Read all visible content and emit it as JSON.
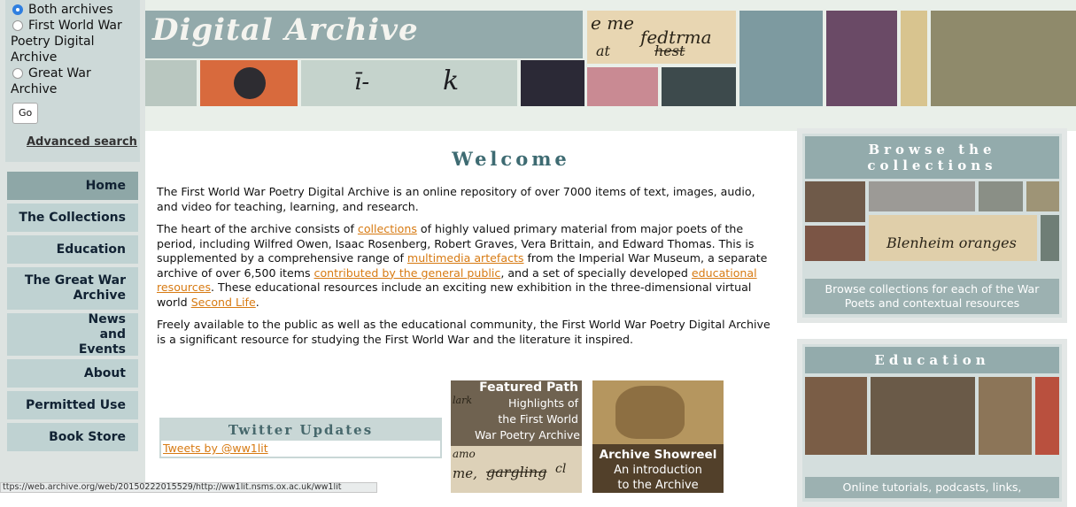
{
  "search": {
    "options": [
      "Both archives",
      "First World War Poetry Digital Archive",
      "Great War Archive"
    ],
    "go_label": "Go",
    "advanced_label": "Advanced search"
  },
  "nav": {
    "items": [
      "Home",
      "The Collections",
      "Education",
      "The Great War Archive",
      "News and Events",
      "About",
      "Permitted Use",
      "Book Store"
    ]
  },
  "header": {
    "title": "Digital Archive",
    "handwriting": [
      "e me",
      "fedtrma",
      "at",
      "hest"
    ]
  },
  "main": {
    "welcome": "Welcome",
    "p1": "The First World War Poetry Digital Archive is an online repository of over 7000 items of text, images, audio, and video for teaching, learning, and research.",
    "p2": {
      "t1": "The heart of the archive consists of ",
      "l1": "collections",
      "t2": " of highly valued primary material from major poets of the period, including Wilfred Owen, Isaac Rosenberg, Robert Graves, Vera Brittain, and Edward Thomas. This is supplemented by a comprehensive range of ",
      "l2": "multimedia artefacts",
      "t3": " from the Imperial War Museum, a separate archive of over 6,500 items ",
      "l3": "contributed by the general public",
      "t4": ", and a set of specially developed ",
      "l4": "educational resources",
      "t5": ". These educational resources include an exciting new exhibition in the three-dimensional virtual world ",
      "l5": "Second Life",
      "t6": "."
    },
    "p3": "Freely available to the public as well as the educational community, the First World War Poetry Digital Archive is a significant resource for studying the First World War and the literature it inspired."
  },
  "twitter": {
    "title": "Twitter Updates",
    "link": "Tweets by @ww1lit"
  },
  "featured": {
    "title": "Featured Path",
    "lines": [
      "Highlights of",
      "the First World",
      "War Poetry Archive"
    ],
    "handwriting": [
      "lark",
      "amo",
      "me,",
      "gargling",
      "cl"
    ]
  },
  "showreel": {
    "title": "Archive Showreel",
    "lines": [
      "An introduction",
      "to the Archive"
    ]
  },
  "browse": {
    "title": "Browse the collections",
    "desc": "Browse collections for each of the War Poets and contextual resources",
    "handwriting": [
      "Blenheim oranges"
    ]
  },
  "education": {
    "title": "Education",
    "desc": "Online tutorials, podcasts, links,"
  },
  "status_url": "ttps://web.archive.org/web/20150222015529/http://ww1lit.nsms.ox.ac.uk/ww1lit"
}
